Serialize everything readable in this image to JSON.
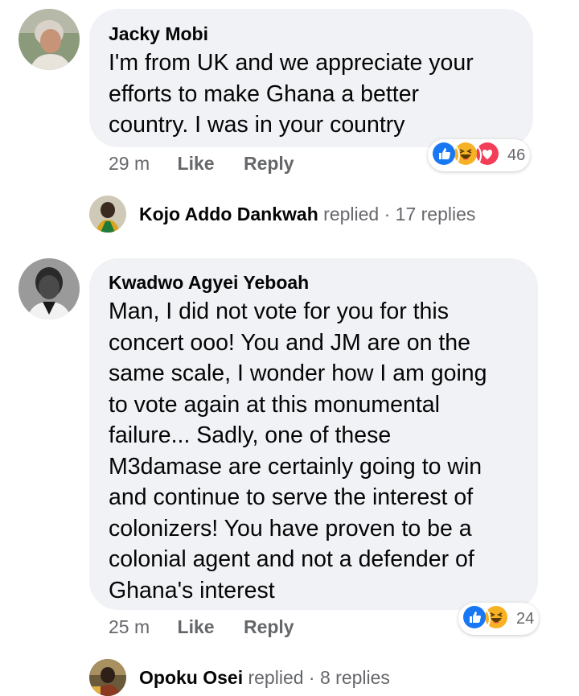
{
  "comments": [
    {
      "author": "Jacky Mobi",
      "lines": [
        "I'm from  UK and we appreciate your",
        "efforts to make Ghana a better",
        "country. I was in your country"
      ],
      "time": "29 m",
      "like_label": "Like",
      "reply_label": "Reply",
      "reactions": [
        "like-icon",
        "haha-icon",
        "love-icon"
      ],
      "reaction_count": "46",
      "replies": {
        "name": "Kojo Addo Dankwah",
        "replied_label": "replied",
        "separator": "·",
        "count_label": "17 replies"
      }
    },
    {
      "author": "Kwadwo Agyei Yeboah",
      "lines": [
        "Man, I did not vote for you for this",
        "concert ooo! You and JM are on the",
        "same scale, I wonder how I am going",
        "to vote again at this monumental",
        "failure... Sadly, one of these",
        "M3damase are certainly going to win",
        "and continue to serve the interest of",
        "colonizers! You have proven to be a",
        "colonial agent and not a defender of",
        "Ghana's interest"
      ],
      "time": "25 m",
      "like_label": "Like",
      "reply_label": "Reply",
      "reactions": [
        "like-icon",
        "haha-icon"
      ],
      "reaction_count": "24",
      "replies": {
        "name": "Opoku Osei",
        "replied_label": "replied",
        "separator": "·",
        "count_label": "8 replies"
      }
    }
  ],
  "colors": {
    "bubble": "#f0f2f5",
    "meta_text": "#65676b",
    "like_blue": "#1877f2",
    "love_red": "#f33e58",
    "haha_yellow": "#f7b125"
  }
}
